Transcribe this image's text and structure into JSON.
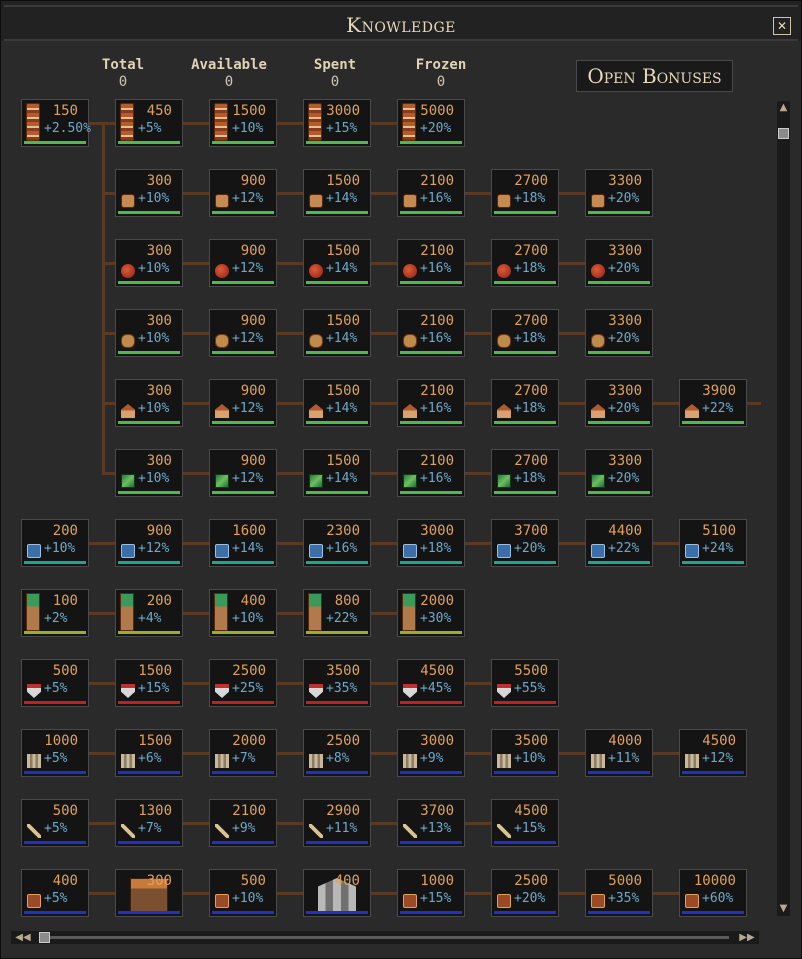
{
  "window": {
    "title": "Knowledge",
    "close_icon": "close-icon"
  },
  "stats": [
    {
      "label": "Total",
      "value": "0"
    },
    {
      "label": "Available",
      "value": "0"
    },
    {
      "label": "Spent",
      "value": "0"
    },
    {
      "label": "Frozen",
      "value": "0"
    }
  ],
  "open_bonuses_label": "Open Bonuses",
  "colors": {
    "cost": "#e0a15a",
    "bonus": "#6fa9c9",
    "connector": "#5a3a22",
    "bar_green": "#4cbb4c",
    "bar_teal": "#18a890",
    "bar_olive": "#98b028",
    "bar_red": "#c02020",
    "bar_blue": "#2030c8"
  },
  "rows": [
    {
      "icon": "totem-icon",
      "bar": "#4cbb4c",
      "nodes": [
        {
          "cost": "150",
          "bonus": "+2.50%"
        },
        {
          "cost": "450",
          "bonus": "+5%"
        },
        {
          "cost": "1500",
          "bonus": "+10%"
        },
        {
          "cost": "3000",
          "bonus": "+15%"
        },
        {
          "cost": "5000",
          "bonus": "+20%"
        }
      ]
    },
    {
      "icon": "mask-icon",
      "bar": "#4cbb4c",
      "nodes": [
        {
          "cost": "300",
          "bonus": "+10%"
        },
        {
          "cost": "900",
          "bonus": "+12%"
        },
        {
          "cost": "1500",
          "bonus": "+14%"
        },
        {
          "cost": "2100",
          "bonus": "+16%"
        },
        {
          "cost": "2700",
          "bonus": "+18%"
        },
        {
          "cost": "3300",
          "bonus": "+20%"
        }
      ]
    },
    {
      "icon": "fruit-icon",
      "bar": "#4cbb4c",
      "nodes": [
        {
          "cost": "300",
          "bonus": "+10%"
        },
        {
          "cost": "900",
          "bonus": "+12%"
        },
        {
          "cost": "1500",
          "bonus": "+14%"
        },
        {
          "cost": "2100",
          "bonus": "+16%"
        },
        {
          "cost": "2700",
          "bonus": "+18%"
        },
        {
          "cost": "3300",
          "bonus": "+20%"
        }
      ]
    },
    {
      "icon": "bread-icon",
      "bar": "#4cbb4c",
      "nodes": [
        {
          "cost": "300",
          "bonus": "+10%"
        },
        {
          "cost": "900",
          "bonus": "+12%"
        },
        {
          "cost": "1500",
          "bonus": "+14%"
        },
        {
          "cost": "2100",
          "bonus": "+16%"
        },
        {
          "cost": "2700",
          "bonus": "+18%"
        },
        {
          "cost": "3300",
          "bonus": "+20%"
        }
      ]
    },
    {
      "icon": "house-icon",
      "bar": "#4cbb4c",
      "nodes": [
        {
          "cost": "300",
          "bonus": "+10%"
        },
        {
          "cost": "900",
          "bonus": "+12%"
        },
        {
          "cost": "1500",
          "bonus": "+14%"
        },
        {
          "cost": "2100",
          "bonus": "+16%"
        },
        {
          "cost": "2700",
          "bonus": "+18%"
        },
        {
          "cost": "3300",
          "bonus": "+20%"
        },
        {
          "cost": "3900",
          "bonus": "+22%"
        }
      ]
    },
    {
      "icon": "scroll-icon",
      "bar": "#4cbb4c",
      "nodes": [
        {
          "cost": "300",
          "bonus": "+10%"
        },
        {
          "cost": "900",
          "bonus": "+12%"
        },
        {
          "cost": "1500",
          "bonus": "+14%"
        },
        {
          "cost": "2100",
          "bonus": "+16%"
        },
        {
          "cost": "2700",
          "bonus": "+18%"
        },
        {
          "cost": "3300",
          "bonus": "+20%"
        }
      ]
    },
    {
      "icon": "map-icon",
      "bar": "#18a890",
      "nodes": [
        {
          "cost": "200",
          "bonus": "+10%"
        },
        {
          "cost": "900",
          "bonus": "+12%"
        },
        {
          "cost": "1600",
          "bonus": "+14%"
        },
        {
          "cost": "2300",
          "bonus": "+16%"
        },
        {
          "cost": "3000",
          "bonus": "+18%"
        },
        {
          "cost": "3700",
          "bonus": "+20%"
        },
        {
          "cost": "4400",
          "bonus": "+22%"
        },
        {
          "cost": "5100",
          "bonus": "+24%"
        }
      ]
    },
    {
      "icon": "banner-icon",
      "bar": "#98b028",
      "nodes": [
        {
          "cost": "100",
          "bonus": "+2%"
        },
        {
          "cost": "200",
          "bonus": "+4%"
        },
        {
          "cost": "400",
          "bonus": "+10%"
        },
        {
          "cost": "800",
          "bonus": "+22%"
        },
        {
          "cost": "2000",
          "bonus": "+30%"
        }
      ]
    },
    {
      "icon": "shield-icon",
      "bar": "#c02020",
      "nodes": [
        {
          "cost": "500",
          "bonus": "+5%"
        },
        {
          "cost": "1500",
          "bonus": "+15%"
        },
        {
          "cost": "2500",
          "bonus": "+25%"
        },
        {
          "cost": "3500",
          "bonus": "+35%"
        },
        {
          "cost": "4500",
          "bonus": "+45%"
        },
        {
          "cost": "5500",
          "bonus": "+55%"
        }
      ]
    },
    {
      "icon": "pillar-icon",
      "bar": "#2030c8",
      "nodes": [
        {
          "cost": "1000",
          "bonus": "+5%"
        },
        {
          "cost": "1500",
          "bonus": "+6%"
        },
        {
          "cost": "2000",
          "bonus": "+7%"
        },
        {
          "cost": "2500",
          "bonus": "+8%"
        },
        {
          "cost": "3000",
          "bonus": "+9%"
        },
        {
          "cost": "3500",
          "bonus": "+10%"
        },
        {
          "cost": "4000",
          "bonus": "+11%"
        },
        {
          "cost": "4500",
          "bonus": "+12%"
        }
      ]
    },
    {
      "icon": "sword-icon",
      "bar": "#2030c8",
      "nodes": [
        {
          "cost": "500",
          "bonus": "+5%"
        },
        {
          "cost": "1300",
          "bonus": "+7%"
        },
        {
          "cost": "2100",
          "bonus": "+9%"
        },
        {
          "cost": "2900",
          "bonus": "+11%"
        },
        {
          "cost": "3700",
          "bonus": "+13%"
        },
        {
          "cost": "4500",
          "bonus": "+15%"
        }
      ]
    },
    {
      "icon": "book-icon",
      "bar": "#2030c8",
      "nodes": [
        {
          "cost": "400",
          "bonus": "+5%"
        },
        {
          "cost": "300",
          "bonus": "",
          "icon": "building-icon"
        },
        {
          "cost": "500",
          "bonus": "+10%"
        },
        {
          "cost": "400",
          "bonus": "",
          "icon": "temple-icon"
        },
        {
          "cost": "1000",
          "bonus": "+15%"
        },
        {
          "cost": "2500",
          "bonus": "+20%"
        },
        {
          "cost": "5000",
          "bonus": "+35%"
        },
        {
          "cost": "10000",
          "bonus": "+60%"
        }
      ]
    }
  ]
}
